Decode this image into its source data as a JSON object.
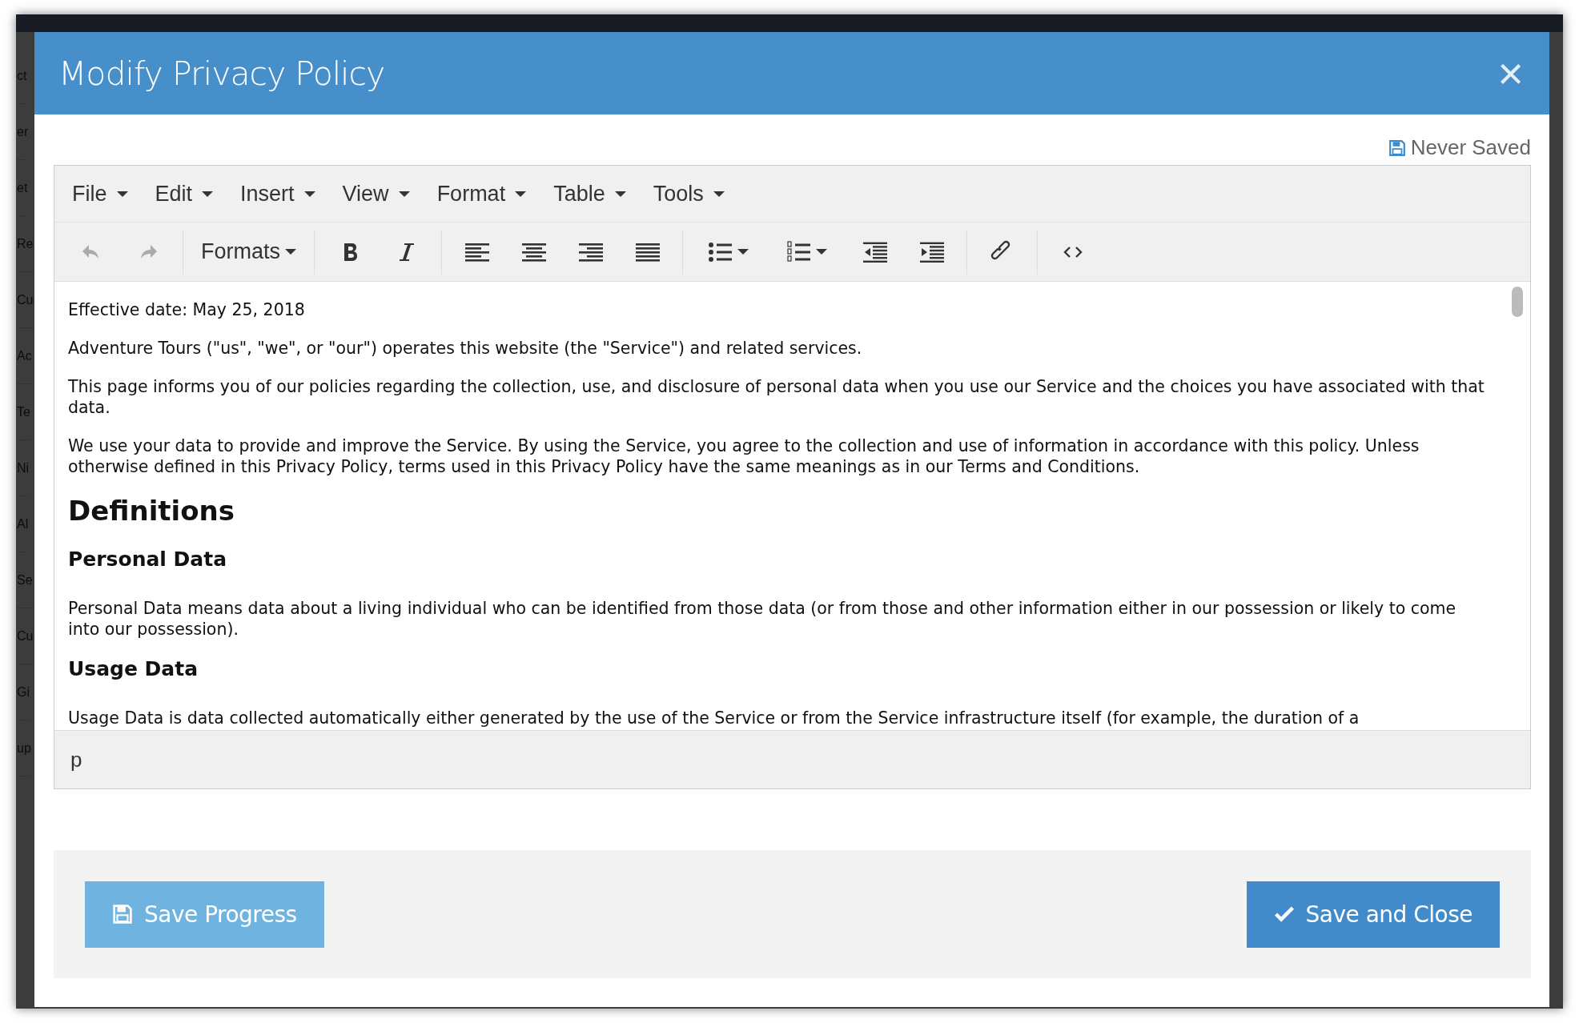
{
  "background": {
    "menu_fragments": [
      "ct",
      "er",
      "et",
      "Re",
      "Cu",
      "Ac",
      "Te",
      "Ni",
      "Al",
      "Se",
      "Cu",
      "Gi",
      "up"
    ]
  },
  "modal": {
    "title": "Modify Privacy Policy",
    "close": "×"
  },
  "save_status": "Never Saved",
  "editor": {
    "menubar": [
      "File",
      "Edit",
      "Insert",
      "View",
      "Format",
      "Table",
      "Tools"
    ],
    "toolbar": [
      [
        {
          "kind": "undo",
          "disabled": true
        },
        {
          "kind": "redo",
          "disabled": true
        }
      ],
      [
        {
          "kind": "formats",
          "label": "Formats",
          "disabled": false
        }
      ],
      [
        {
          "kind": "bold",
          "disabled": false
        },
        {
          "kind": "italic",
          "disabled": false
        }
      ],
      [
        {
          "kind": "align-left",
          "disabled": false
        },
        {
          "kind": "align-center",
          "disabled": false
        },
        {
          "kind": "align-right",
          "disabled": false
        },
        {
          "kind": "align-justify",
          "disabled": false
        }
      ],
      [
        {
          "kind": "bullet-list",
          "disabled": false
        },
        {
          "kind": "numbered-list",
          "disabled": false
        },
        {
          "kind": "outdent",
          "disabled": false
        },
        {
          "kind": "indent",
          "disabled": false
        }
      ],
      [
        {
          "kind": "link",
          "disabled": false
        }
      ],
      [
        {
          "kind": "code",
          "disabled": false
        }
      ]
    ],
    "content": [
      {
        "kind": "p",
        "text": "Effective date: May 25, 2018"
      },
      {
        "kind": "p",
        "text": "Adventure Tours (\"us\", \"we\", or \"our\") operates this website (the \"Service\") and related services."
      },
      {
        "kind": "p",
        "text": "This page informs you of our policies regarding the collection, use, and disclosure of personal data when you use our Service and the choices you have associated with that data."
      },
      {
        "kind": "p",
        "text": "We use your data to provide and improve the Service. By using the Service, you agree to the collection and use of information in accordance with this policy. Unless otherwise defined in this Privacy Policy, terms used in this Privacy Policy have the same meanings as in our Terms and Conditions."
      },
      {
        "kind": "h1",
        "text": "Definitions"
      },
      {
        "kind": "h2",
        "text": "Personal Data"
      },
      {
        "kind": "p",
        "text": "Personal Data means data about a living individual who can be identified from those data (or from those and other information either in our possession or likely to come into our possession)."
      },
      {
        "kind": "h2",
        "text": "Usage Data"
      },
      {
        "kind": "p",
        "text": "Usage Data is data collected automatically either generated by the use of the Service or from the Service infrastructure itself (for example, the duration of a"
      }
    ],
    "status_path": "p"
  },
  "buttons": [
    {
      "kind": "secondary",
      "label": "Save Progress"
    },
    {
      "kind": "primary",
      "label": "Save and Close"
    }
  ]
}
